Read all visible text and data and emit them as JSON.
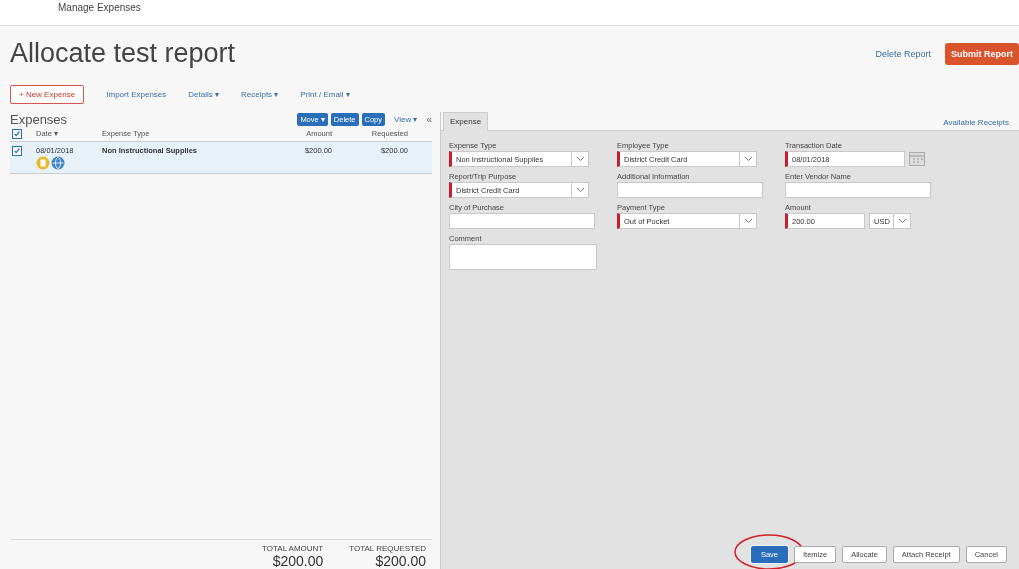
{
  "breadcrumb": "Manage Expenses",
  "title": "Allocate test report",
  "header_actions": {
    "delete": "Delete Report",
    "submit": "Submit Report"
  },
  "toolbar": [
    {
      "label": "+ New Expense",
      "kind": "primary"
    },
    {
      "label": "Import Expenses",
      "kind": "link"
    },
    {
      "label": "Details ▾",
      "kind": "link"
    },
    {
      "label": "Receipts ▾",
      "kind": "link"
    },
    {
      "label": "Print / Email ▾",
      "kind": "link"
    }
  ],
  "expenses": {
    "heading": "Expenses",
    "actions": [
      "Move ▾",
      "Delete",
      "Copy"
    ],
    "view": "View ▾",
    "collapse": "«",
    "columns": [
      "Date ▾",
      "Expense Type",
      "Amount",
      "Requested"
    ],
    "all_checked": true,
    "rows": [
      {
        "checked": true,
        "selected": true,
        "date": "08/01/2018",
        "type": "Non Instructional Supplies",
        "amount": "$200.00",
        "requested": "$200.00"
      }
    ],
    "totals": [
      {
        "label": "TOTAL AMOUNT",
        "value": "$200.00"
      },
      {
        "label": "TOTAL REQUESTED",
        "value": "$200.00"
      }
    ]
  },
  "detail": {
    "tabs": [
      {
        "label": "Expense",
        "selected": true
      }
    ],
    "receipts_link": "Available Receipts",
    "fields": [
      {
        "label": "Expense Type",
        "kind": "select",
        "value": "Non Instructional Supplies",
        "required": true
      },
      {
        "label": "Employee Type",
        "kind": "select",
        "value": "District Credit Card",
        "required": true
      },
      {
        "label": "Transaction Date",
        "kind": "date",
        "value": "08/01/2018",
        "required": true
      },
      {
        "label": "Report/Trip Purpose",
        "kind": "select",
        "value": "District Credit Card",
        "required": true
      },
      {
        "label": "Additional Information",
        "kind": "text",
        "required": false
      },
      {
        "label": "Enter Vendor Name",
        "kind": "text",
        "required": false
      },
      {
        "label": "City of Purchase",
        "kind": "text",
        "required": false
      },
      {
        "label": "Payment Type",
        "kind": "select",
        "value": "Out of Pocket",
        "required": true
      },
      {
        "label": "Amount",
        "kind": "amount",
        "value": "200.00",
        "currency": "USD",
        "required": true
      },
      {
        "label": "Comment",
        "kind": "textarea",
        "required": false
      }
    ],
    "buttons": [
      {
        "label": "Save",
        "kind": "primary",
        "highlighted": true
      },
      {
        "label": "Itemize",
        "kind": "plain",
        "highlighted": false
      },
      {
        "label": "Allocate",
        "kind": "plain",
        "highlighted": false
      },
      {
        "label": "Attach Receipt",
        "kind": "plain",
        "highlighted": false
      },
      {
        "label": "Cancel",
        "kind": "plain",
        "highlighted": false
      }
    ]
  }
}
